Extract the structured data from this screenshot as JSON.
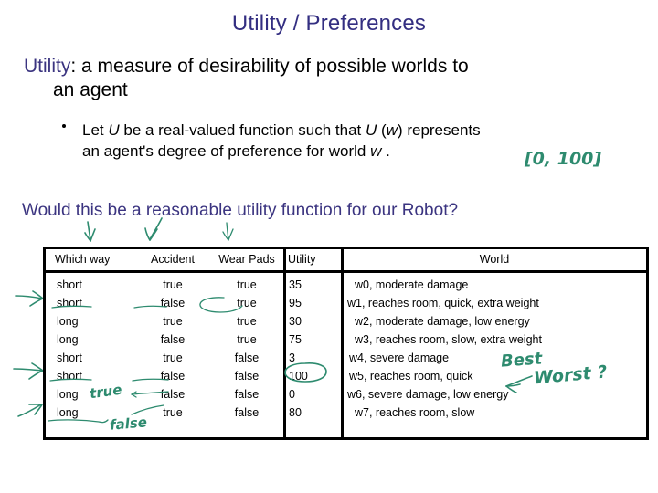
{
  "slide": {
    "title": "Utility / Preferences",
    "title_color": "#332e81",
    "body": {
      "keyword": "Utility",
      "rest_line1": ": a measure of desirability of possible worlds to",
      "line2": "an agent"
    },
    "bullet": {
      "marker": "•",
      "line1_a": "Let ",
      "line1_var1": "U",
      "line1_b": " be a real-valued function such that ",
      "line1_var2": "U",
      "line1_c": " (",
      "line1_var3": "w",
      "line1_d": ") represents",
      "line2_a": "an agent's degree of preference for world ",
      "line2_var": "w",
      "line2_b": " ."
    },
    "question": "Would this be a reasonable utility function for our Robot?"
  },
  "table": {
    "headers": [
      "Which way",
      "Accident",
      "Wear Pads",
      "Utility",
      "World"
    ],
    "rows": [
      {
        "which_way": "short",
        "accident": "true",
        "wear_pads": "true",
        "utility": "35",
        "world": "w0,  moderate damage"
      },
      {
        "which_way": "short",
        "accident": "false",
        "wear_pads": "true",
        "utility": "95",
        "world": "w1, reaches room, quick, extra weight"
      },
      {
        "which_way": "long",
        "accident": "true",
        "wear_pads": "true",
        "utility": "30",
        "world": "w2,  moderate damage, low energy"
      },
      {
        "which_way": "long",
        "accident": "false",
        "wear_pads": "true",
        "utility": "75",
        "world": "w3,  reaches room, slow, extra weight"
      },
      {
        "which_way": "short",
        "accident": "true",
        "wear_pads": "false",
        "utility": "3",
        "world": "w4, severe damage"
      },
      {
        "which_way": "short",
        "accident": "false",
        "wear_pads": "false",
        "utility": "100",
        "world": "w5, reaches room, quick"
      },
      {
        "which_way": "long",
        "accident": "false",
        "wear_pads": "false",
        "utility": "0",
        "world": "w6,  severe damage, low energy"
      },
      {
        "which_way": "long",
        "accident": "true",
        "wear_pads": "false",
        "utility": "80",
        "world": "w7,  reaches room, slow"
      }
    ]
  },
  "annotations": {
    "ink_color": "#2e8b6f",
    "range_bracket": "[0, 100]",
    "best_label": "Best",
    "worst_label": "Worst ?",
    "accident_edit_true": "true",
    "accident_edit_false": "false",
    "arrow_down_count": 3,
    "arrow_right_count": 3,
    "circled_utility": "100",
    "circled_wear_pads": "true"
  }
}
